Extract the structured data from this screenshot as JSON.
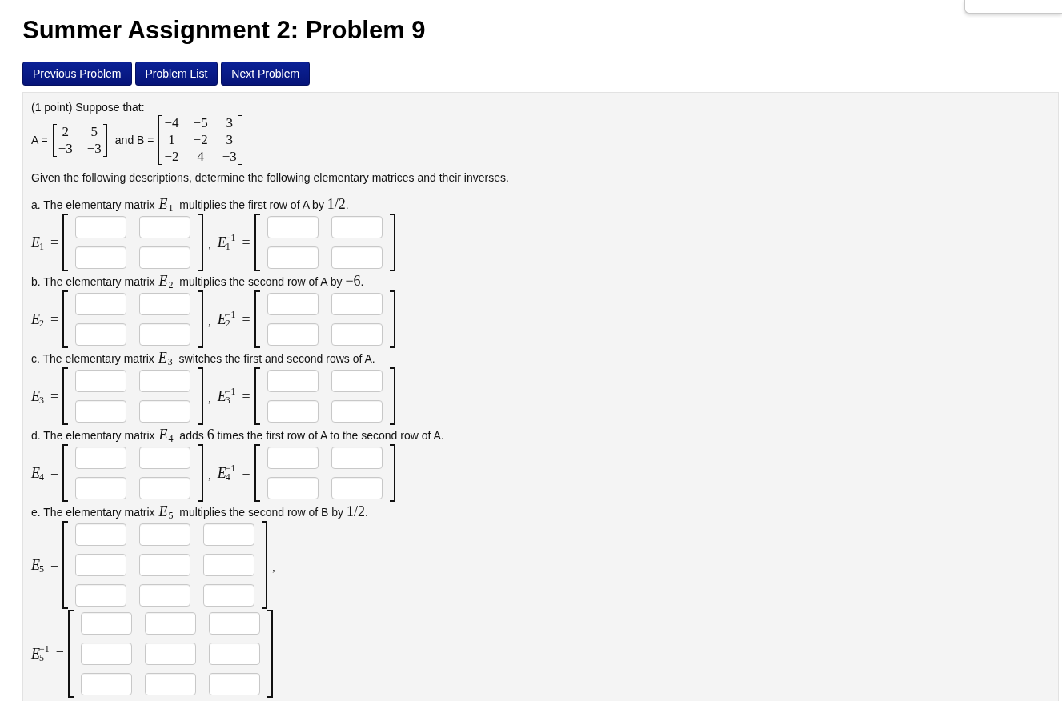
{
  "title": "Summer Assignment 2: Problem 9",
  "nav_buttons": [
    {
      "label": "Previous Problem"
    },
    {
      "label": "Problem List"
    },
    {
      "label": "Next Problem"
    }
  ],
  "problem": {
    "intro": "(1 point) Suppose that:",
    "given": [
      {
        "label": "A =",
        "rows": [
          [
            "2",
            "5"
          ],
          [
            "−3",
            "−3"
          ]
        ]
      },
      {
        "label": "and B =",
        "rows": [
          [
            "−4",
            "−5",
            "3"
          ],
          [
            "1",
            "−2",
            "3"
          ],
          [
            "−2",
            "4",
            "−3"
          ]
        ]
      }
    ],
    "instructions": "Given the following descriptions, determine the following elementary matrices and their inverses.",
    "parts": [
      {
        "prompt": [
          {
            "kind": "text",
            "text": "a. The elementary matrix "
          },
          {
            "kind": "var",
            "text": "E",
            "sub": "1"
          },
          {
            "kind": "text",
            "text": " multiplies the first row of A by "
          },
          {
            "kind": "num",
            "text": "1/2"
          },
          {
            "kind": "text",
            "text": "."
          }
        ],
        "lines": [
          [
            {
              "symbol": "E",
              "sub": "1",
              "equals": "=",
              "rows": [
                [
                  {
                    "kind": "blank"
                  },
                  {
                    "kind": "blank"
                  }
                ],
                [
                  {
                    "kind": "blank"
                  },
                  {
                    "kind": "blank"
                  }
                ]
              ],
              "punct": ","
            },
            {
              "symbol": "E",
              "sub": "1",
              "sup": "−1",
              "equals": "=",
              "rows": [
                [
                  {
                    "kind": "blank"
                  },
                  {
                    "kind": "blank"
                  }
                ],
                [
                  {
                    "kind": "blank"
                  },
                  {
                    "kind": "blank"
                  }
                ]
              ]
            }
          ]
        ]
      },
      {
        "prompt": [
          {
            "kind": "text",
            "text": "b. The elementary matrix "
          },
          {
            "kind": "var",
            "text": "E",
            "sub": "2"
          },
          {
            "kind": "text",
            "text": " multiplies the second row of A by "
          },
          {
            "kind": "num",
            "text": "−6"
          },
          {
            "kind": "text",
            "text": "."
          }
        ],
        "lines": [
          [
            {
              "symbol": "E",
              "sub": "2",
              "equals": "=",
              "rows": [
                [
                  {
                    "kind": "blank"
                  },
                  {
                    "kind": "blank"
                  }
                ],
                [
                  {
                    "kind": "blank"
                  },
                  {
                    "kind": "blank"
                  }
                ]
              ],
              "punct": ","
            },
            {
              "symbol": "E",
              "sub": "2",
              "sup": "−1",
              "equals": "=",
              "rows": [
                [
                  {
                    "kind": "blank"
                  },
                  {
                    "kind": "blank"
                  }
                ],
                [
                  {
                    "kind": "blank"
                  },
                  {
                    "kind": "blank"
                  }
                ]
              ]
            }
          ]
        ]
      },
      {
        "prompt": [
          {
            "kind": "text",
            "text": "c. The elementary matrix "
          },
          {
            "kind": "var",
            "text": "E",
            "sub": "3"
          },
          {
            "kind": "text",
            "text": " switches the first and second rows of A."
          }
        ],
        "lines": [
          [
            {
              "symbol": "E",
              "sub": "3",
              "equals": "=",
              "rows": [
                [
                  {
                    "kind": "blank"
                  },
                  {
                    "kind": "blank"
                  }
                ],
                [
                  {
                    "kind": "blank"
                  },
                  {
                    "kind": "blank"
                  }
                ]
              ],
              "punct": ","
            },
            {
              "symbol": "E",
              "sub": "3",
              "sup": "−1",
              "equals": "=",
              "rows": [
                [
                  {
                    "kind": "blank"
                  },
                  {
                    "kind": "blank"
                  }
                ],
                [
                  {
                    "kind": "blank"
                  },
                  {
                    "kind": "blank"
                  }
                ]
              ]
            }
          ]
        ]
      },
      {
        "prompt": [
          {
            "kind": "text",
            "text": "d. The elementary matrix "
          },
          {
            "kind": "var",
            "text": "E",
            "sub": "4"
          },
          {
            "kind": "text",
            "text": " adds "
          },
          {
            "kind": "num",
            "text": "6"
          },
          {
            "kind": "text",
            "text": " times the first row of A to the second row of A."
          }
        ],
        "lines": [
          [
            {
              "symbol": "E",
              "sub": "4",
              "equals": "=",
              "rows": [
                [
                  {
                    "kind": "blank"
                  },
                  {
                    "kind": "blank"
                  }
                ],
                [
                  {
                    "kind": "blank"
                  },
                  {
                    "kind": "blank"
                  }
                ]
              ],
              "punct": ","
            },
            {
              "symbol": "E",
              "sub": "4",
              "sup": "−1",
              "equals": "=",
              "rows": [
                [
                  {
                    "kind": "blank"
                  },
                  {
                    "kind": "blank"
                  }
                ],
                [
                  {
                    "kind": "blank"
                  },
                  {
                    "kind": "blank"
                  }
                ]
              ]
            }
          ]
        ]
      },
      {
        "prompt": [
          {
            "kind": "text",
            "text": "e. The elementary matrix "
          },
          {
            "kind": "var",
            "text": "E",
            "sub": "5"
          },
          {
            "kind": "text",
            "text": " multiplies the second row of B by "
          },
          {
            "kind": "num",
            "text": "1/2"
          },
          {
            "kind": "text",
            "text": "."
          }
        ],
        "lines": [
          [
            {
              "symbol": "E",
              "sub": "5",
              "equals": "=",
              "rows": [
                [
                  {
                    "kind": "blank"
                  },
                  {
                    "kind": "blank"
                  },
                  {
                    "kind": "blank"
                  }
                ],
                [
                  {
                    "kind": "blank"
                  },
                  {
                    "kind": "blank"
                  },
                  {
                    "kind": "blank"
                  }
                ],
                [
                  {
                    "kind": "blank"
                  },
                  {
                    "kind": "blank"
                  },
                  {
                    "kind": "blank"
                  }
                ]
              ],
              "punct": ","
            }
          ],
          [
            {
              "symbol": "E",
              "sub": "5",
              "sup": "−1",
              "equals": "=",
              "rows": [
                [
                  {
                    "kind": "blank"
                  },
                  {
                    "kind": "blank"
                  },
                  {
                    "kind": "blank"
                  }
                ],
                [
                  {
                    "kind": "blank"
                  },
                  {
                    "kind": "blank"
                  },
                  {
                    "kind": "blank"
                  }
                ],
                [
                  {
                    "kind": "blank"
                  },
                  {
                    "kind": "blank"
                  },
                  {
                    "kind": "blank"
                  }
                ]
              ]
            }
          ]
        ]
      }
    ]
  }
}
